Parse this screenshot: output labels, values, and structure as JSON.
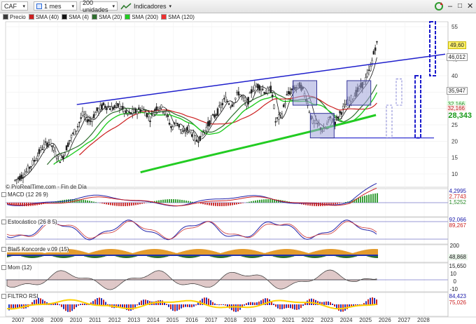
{
  "toolbar": {
    "symbol": "CAF",
    "period": "1 mes",
    "units": "200 unidades",
    "indicators_label": "Indicadores"
  },
  "legend": [
    {
      "label": "Precio",
      "color": "#3a3a3a"
    },
    {
      "label": "SMA (40)",
      "color": "#cc2020"
    },
    {
      "label": "SMA (4)",
      "color": "#111111"
    },
    {
      "label": "SMA (20)",
      "color": "#2f6e2f"
    },
    {
      "label": "SMA (200)",
      "color": "#22cc22"
    },
    {
      "label": "SMA (120)",
      "color": "#ee3030"
    }
  ],
  "watermark": "© ProRealTime.com - Fin de Día",
  "price_axis": {
    "ticks": [
      "55",
      "45",
      "40",
      "35",
      "30",
      "25",
      "20",
      "15",
      "10"
    ],
    "last_price": "49,60",
    "badge_46": "46,012",
    "badge_36": "35,947",
    "badge_32a": "32,166",
    "badge_32b": "32,166",
    "badge_28": "28,343"
  },
  "x_axis": [
    "2007",
    "2008",
    "2009",
    "2010",
    "2011",
    "2012",
    "2013",
    "2014",
    "2015",
    "2016",
    "2017",
    "2018",
    "2019",
    "2020",
    "2021",
    "2022",
    "2023",
    "2024",
    "2025",
    "2026",
    "2027",
    "2028"
  ],
  "panes": {
    "macd": {
      "label": "MACD (12 26 9)",
      "values": [
        "4,2995",
        "2,7743",
        "1,5252"
      ]
    },
    "stoch": {
      "label": "Estocástico (26 8 5)",
      "values": [
        "92,066",
        "89,267"
      ]
    },
    "blai5": {
      "label": "Blai5 Koncorde v.09 (15)",
      "values": [
        "200",
        "48,868"
      ]
    },
    "mom": {
      "label": "Mom (12)",
      "values": [
        "15,650",
        "10",
        "0",
        "-10"
      ]
    },
    "rsi": {
      "label": "FILTRO RSI",
      "values": [
        "84,423",
        "75,026"
      ]
    }
  },
  "colors": {
    "trendline": "#1f1fcc",
    "price_box": "#5b5bbd",
    "dashed_box": "#1a1acc",
    "sma200": "#22cc22",
    "sma20": "#2f6e2f",
    "sma40": "#cc2020",
    "macd_pos": "#3aa03a",
    "macd_neg": "#cc3333"
  }
}
